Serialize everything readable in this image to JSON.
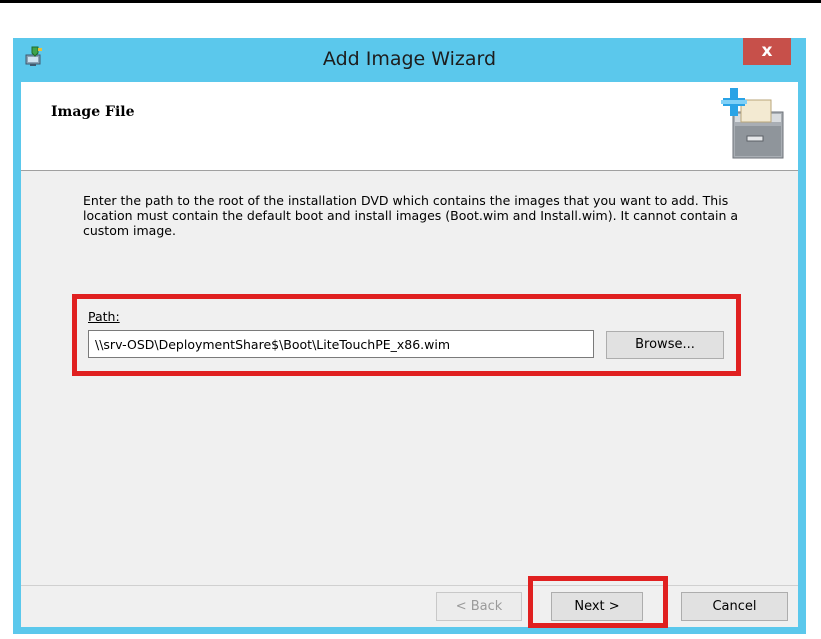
{
  "window": {
    "title": "Add Image Wizard",
    "close_label": "x",
    "app_icon": "wizard-computer-icon"
  },
  "header": {
    "page_title": "Image File",
    "icon": "add-image-cabinet-icon"
  },
  "main": {
    "description": "Enter the path to the root of the installation DVD which contains the images that you want to add. This location must contain the default boot and install images (Boot.wim and Install.wim). It cannot contain a custom image.",
    "path_label": "Path:",
    "path_value": "\\\\srv-OSD\\DeploymentShare$\\Boot\\LiteTouchPE_x86.wim",
    "browse_label": "Browse..."
  },
  "footer": {
    "back_label": "< Back",
    "next_label": "Next >",
    "cancel_label": "Cancel"
  },
  "colors": {
    "window_frame": "#5bc8ec",
    "close_button": "#c7504a",
    "highlight": "#e02020",
    "client_bg": "#f0f0f0"
  }
}
